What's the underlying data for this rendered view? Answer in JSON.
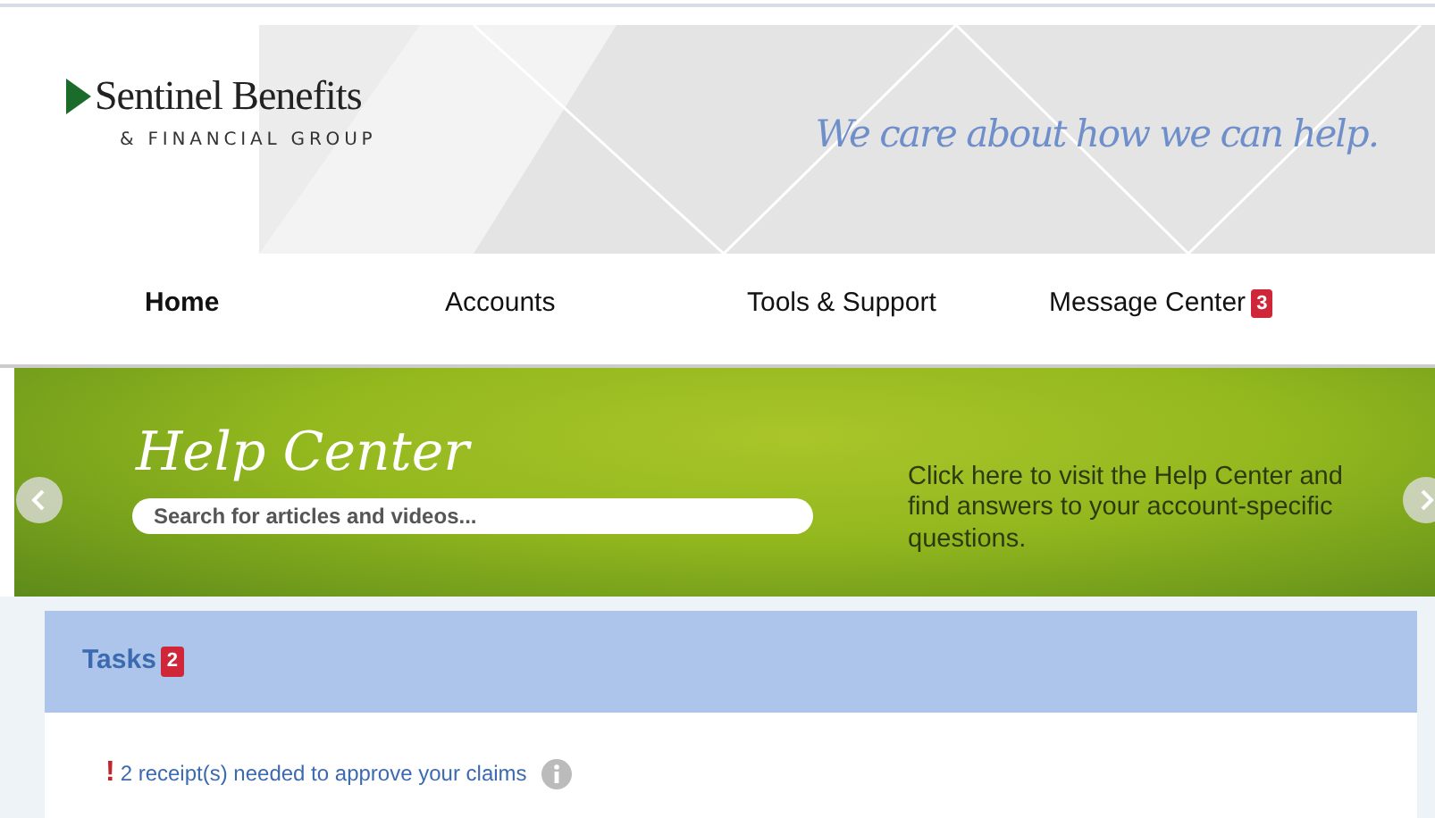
{
  "header": {
    "logo_name": "Sentinel Benefits",
    "logo_sub": "& FINANCIAL GROUP",
    "tagline": "We care about how we can help."
  },
  "nav": [
    {
      "label": "Home",
      "selected": true
    },
    {
      "label": "Accounts",
      "selected": false
    },
    {
      "label": "Tools & Support",
      "selected": false
    },
    {
      "label": "Message Center",
      "selected": false,
      "badge": "3"
    }
  ],
  "banner": {
    "title": "Help Center",
    "search": {
      "placeholder": "Search for articles and videos..."
    },
    "text": "Click here to visit the Help Center and find answers to your account-specific questions."
  },
  "tasks": {
    "title": "Tasks",
    "badge": "2",
    "items": [
      {
        "mark": "!",
        "text": "2 receipt(s) needed to approve your claims"
      }
    ]
  }
}
